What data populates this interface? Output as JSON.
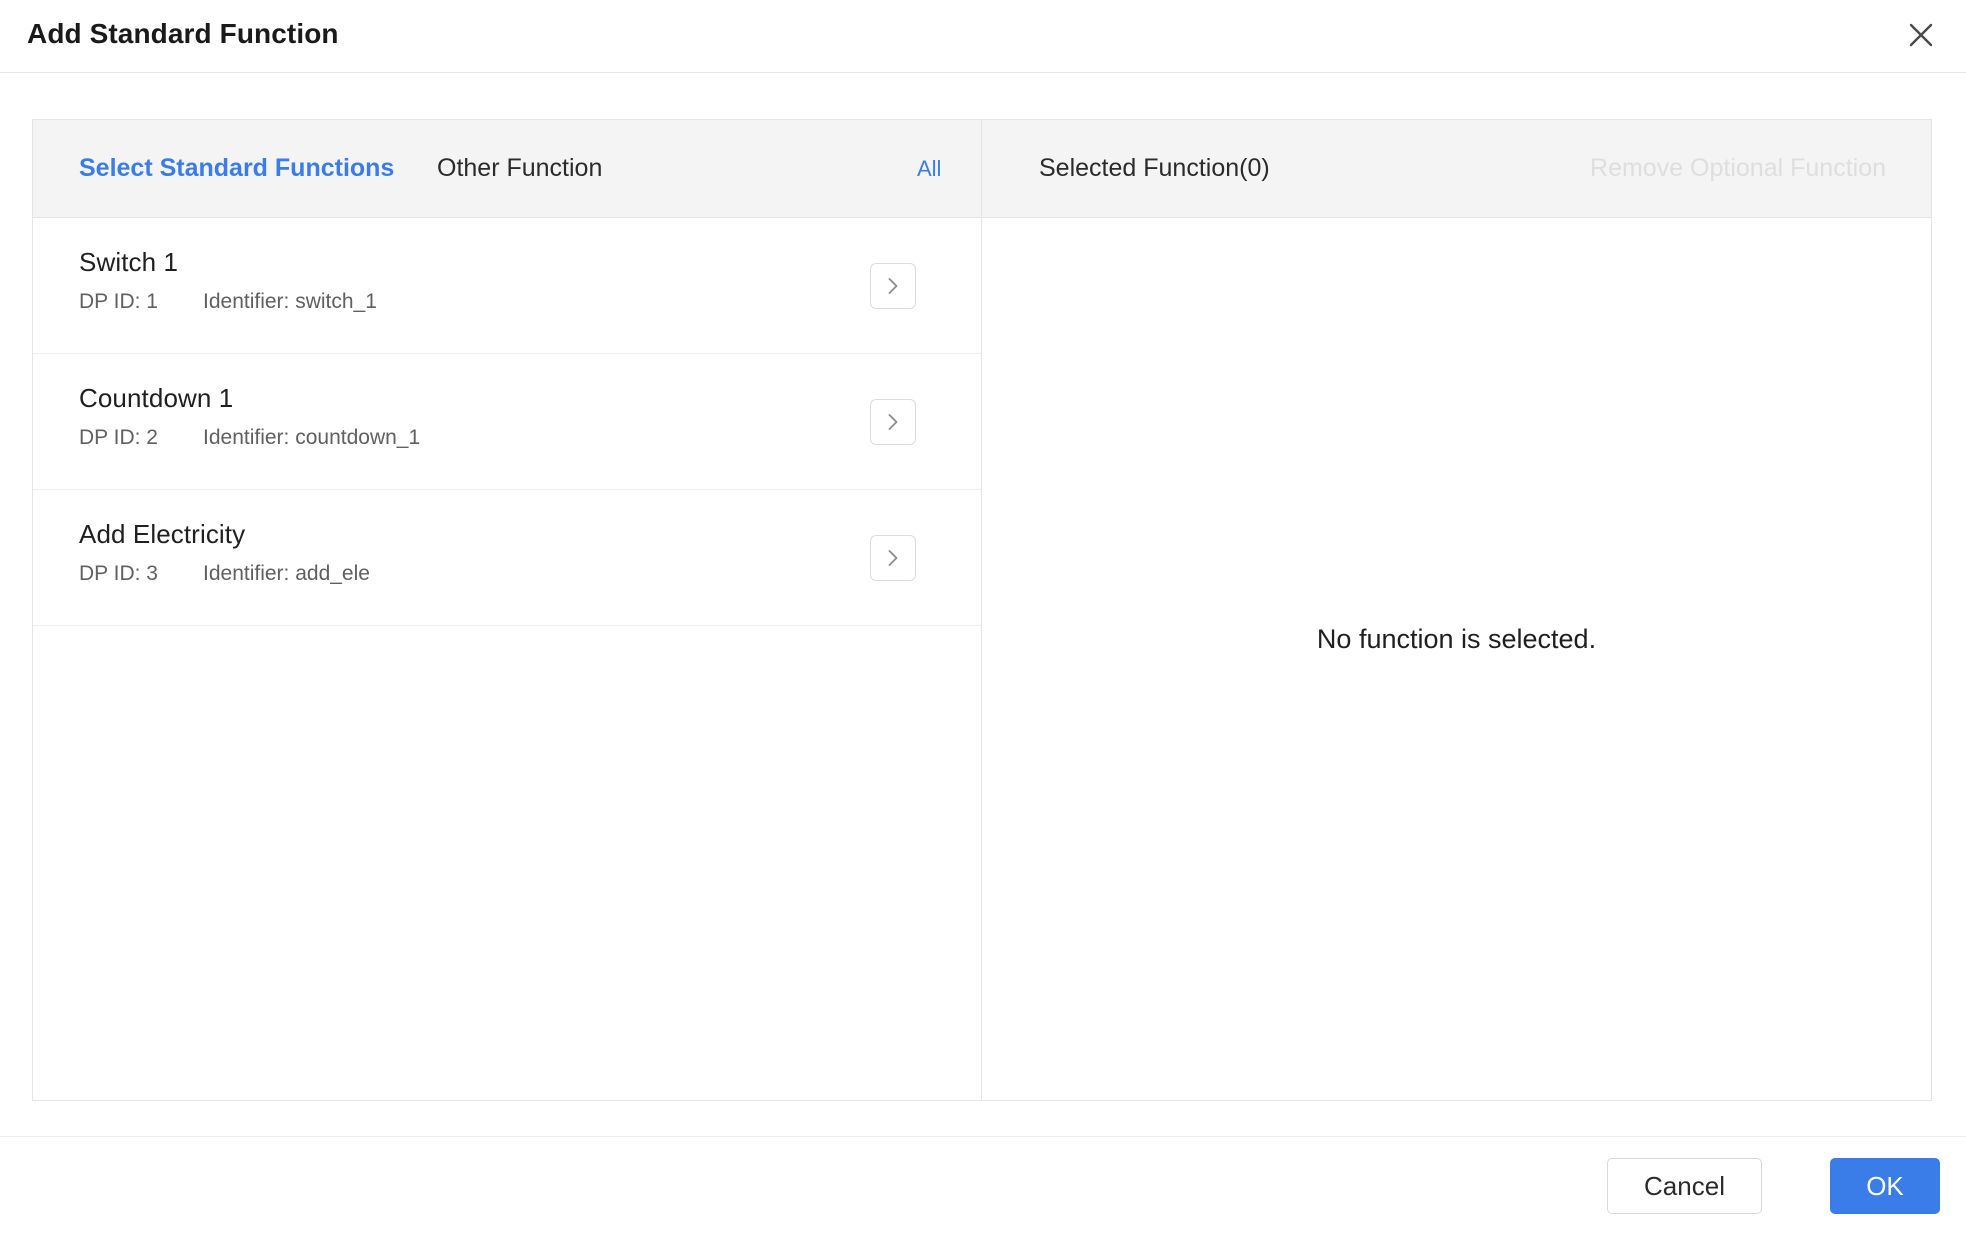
{
  "dialog": {
    "title": "Add Standard Function",
    "close_icon": "close-icon"
  },
  "left_panel": {
    "tabs": [
      {
        "label": "Select Standard Functions",
        "active": true
      },
      {
        "label": "Other Function",
        "active": false
      }
    ],
    "all_link": "All",
    "functions": [
      {
        "name": "Switch 1",
        "dp_id_label": "DP ID: 1",
        "identifier_label": "Identifier: switch_1",
        "action_icon": "chevron-right-icon"
      },
      {
        "name": "Countdown 1",
        "dp_id_label": "DP ID: 2",
        "identifier_label": "Identifier: countdown_1",
        "action_icon": "chevron-right-icon"
      },
      {
        "name": "Add Electricity",
        "dp_id_label": "DP ID: 3",
        "identifier_label": "Identifier: add_ele",
        "action_icon": "chevron-right-icon"
      }
    ]
  },
  "right_panel": {
    "title": "Selected Function(0)",
    "remove_optional_label": "Remove Optional Function",
    "empty_text": "No function is selected."
  },
  "footer": {
    "cancel_label": "Cancel",
    "ok_label": "OK"
  },
  "colors": {
    "accent_blue": "#3a7ce8",
    "header_bg": "#f4f4f4",
    "border": "#e4e4e4",
    "disabled_text": "#dedede"
  }
}
